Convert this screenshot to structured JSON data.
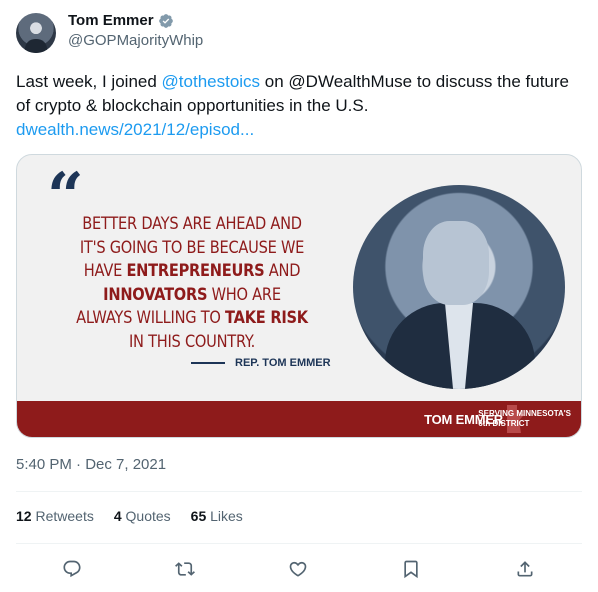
{
  "author": {
    "name": "Tom Emmer",
    "handle": "@GOPMajorityWhip"
  },
  "tweet": {
    "text_part1": "Last week, I joined ",
    "mention": "@tothestoics",
    "text_part2": " on @DWealthMuse to discuss the future of crypto & blockchain opportunities in the U.S.",
    "link": "dwealth.news/2021/12/episod..."
  },
  "card": {
    "quote_mark": "“",
    "quote_lines": [
      "Better days are ahead and",
      "it's going to be because we",
      "have ",
      "Entrepreneurs",
      " and",
      "Innovators",
      " who are",
      "always willing to ",
      "Take Risk",
      "in this country."
    ],
    "attribution": "REP. TOM EMMER",
    "banner_name": "TOM EMMER",
    "banner_district_line1": "SERVING MINNESOTA'S",
    "banner_district_line2": "6th DISTRICT"
  },
  "timestamp": "5:40 PM · Dec 7, 2021",
  "stats": {
    "retweets_count": "12",
    "retweets_label": "Retweets",
    "quotes_count": "4",
    "quotes_label": "Quotes",
    "likes_count": "65",
    "likes_label": "Likes"
  },
  "actions": [
    "reply-icon",
    "retweet-icon",
    "like-icon",
    "bookmark-icon",
    "share-icon"
  ],
  "colors": {
    "link": "#1d9bf0",
    "verified": "#829aab",
    "brand_red": "#8e1b1b",
    "navy": "#1d3557"
  }
}
